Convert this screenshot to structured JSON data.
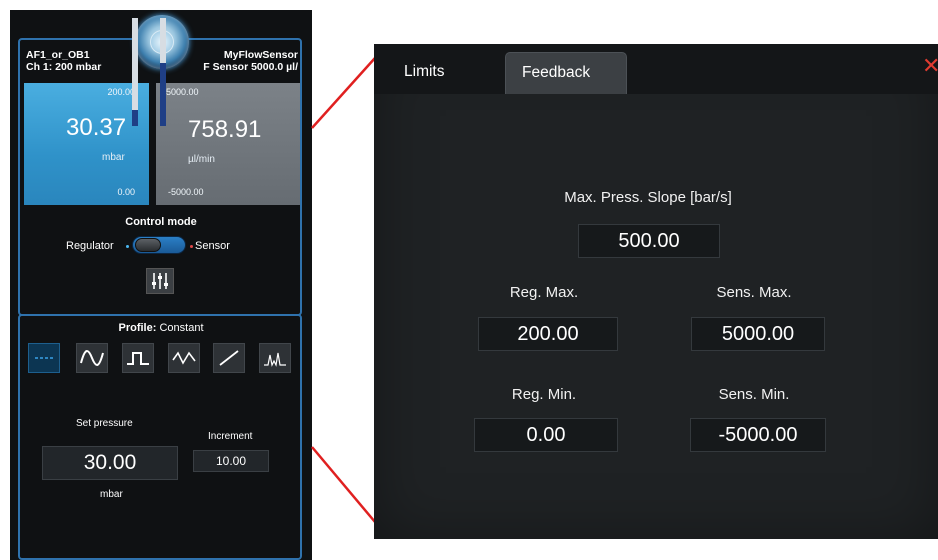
{
  "left_panel": {
    "channel_name": "AF1_or_OB1",
    "channel_info": "Ch 1: 200 mbar",
    "sensor_name": "MyFlowSensor",
    "sensor_info": "F Sensor 5000.0 µl/",
    "pressure": {
      "max": "200.00",
      "value": "30.37",
      "unit": "mbar",
      "min": "0.00",
      "bar_level": 0.15
    },
    "flow": {
      "max": "5000.00",
      "value": "758.91",
      "unit": "µl/min",
      "min": "-5000.00",
      "bar_level": 0.58
    },
    "control_mode": {
      "title": "Control mode",
      "left_label": "Regulator",
      "right_label": "Sensor",
      "state": "Sensor"
    },
    "profile": {
      "label": "Profile:",
      "value": "Constant",
      "buttons": [
        "constant-icon",
        "sine-wave-icon",
        "square-wave-icon",
        "triangle-wave-icon",
        "ramp-icon",
        "peaks-icon"
      ],
      "active_index": 0
    },
    "set_pressure": {
      "label": "Set pressure",
      "value": "30.00",
      "unit": "mbar"
    },
    "increment": {
      "label": "Increment",
      "value": "10.00"
    }
  },
  "limits_panel": {
    "tabs": [
      {
        "label": "Limits",
        "active": false
      },
      {
        "label": "Feedback",
        "active": true
      }
    ],
    "close_icon": "close-icon",
    "max_press_slope": {
      "label": "Max. Press. Slope [bar/s]",
      "value": "500.00"
    },
    "reg_max": {
      "label": "Reg. Max.",
      "value": "200.00"
    },
    "sens_max": {
      "label": "Sens. Max.",
      "value": "5000.00"
    },
    "reg_min": {
      "label": "Reg. Min.",
      "value": "0.00"
    },
    "sens_min": {
      "label": "Sens. Min.",
      "value": "-5000.00"
    }
  },
  "colors": {
    "pressure_box": "#2f92c9",
    "flow_box": "#666c72",
    "frame_blue": "#2f72ad",
    "connector_red": "#e02020",
    "close_red": "#e03b30",
    "panel_background": "#1f2224"
  }
}
